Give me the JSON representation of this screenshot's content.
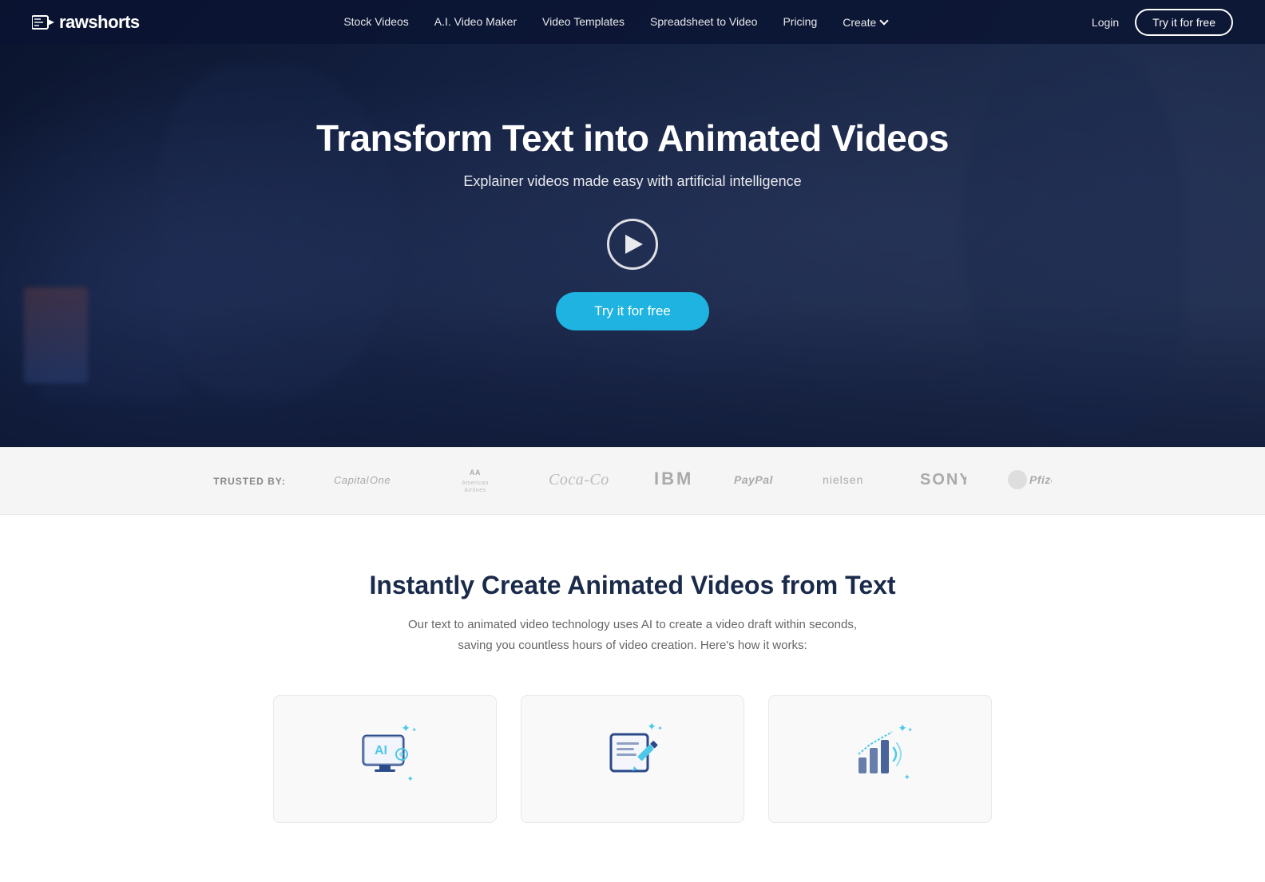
{
  "navbar": {
    "logo_text_plain": "raw",
    "logo_text_bold": "shorts",
    "links": [
      {
        "label": "Stock Videos",
        "id": "stock-videos"
      },
      {
        "label": "A.I. Video Maker",
        "id": "ai-video-maker"
      },
      {
        "label": "Video Templates",
        "id": "video-templates"
      },
      {
        "label": "Spreadsheet to Video",
        "id": "spreadsheet-to-video"
      },
      {
        "label": "Pricing",
        "id": "pricing"
      },
      {
        "label": "Create",
        "id": "create",
        "has_dropdown": true
      }
    ],
    "login_label": "Login",
    "try_btn_label": "Try it for free"
  },
  "hero": {
    "title": "Transform Text into Animated Videos",
    "subtitle": "Explainer videos made easy with artificial intelligence",
    "cta_label": "Try it for free"
  },
  "trusted": {
    "label": "TRUSTED BY:",
    "logos": [
      {
        "name": "Capital One",
        "class": "capital-one"
      },
      {
        "name": "American Airlines",
        "class": "aa"
      },
      {
        "name": "Coca-Cola",
        "class": "coca-cola"
      },
      {
        "name": "IBM",
        "class": "ibm"
      },
      {
        "name": "PayPal",
        "class": "paypal"
      },
      {
        "name": "Nielsen",
        "class": "nielsen"
      },
      {
        "name": "SONY",
        "class": "sony"
      },
      {
        "name": "Pfizer",
        "class": "pfizer"
      }
    ]
  },
  "section": {
    "title": "Instantly Create Animated Videos from Text",
    "description": "Our text to animated video technology uses AI to create a video draft within seconds, saving you countless hours of video creation. Here's how it works:",
    "cards": [
      {
        "id": "ai-card",
        "icon_type": "ai"
      },
      {
        "id": "edit-card",
        "icon_type": "edit"
      },
      {
        "id": "publish-card",
        "icon_type": "publish"
      }
    ]
  }
}
